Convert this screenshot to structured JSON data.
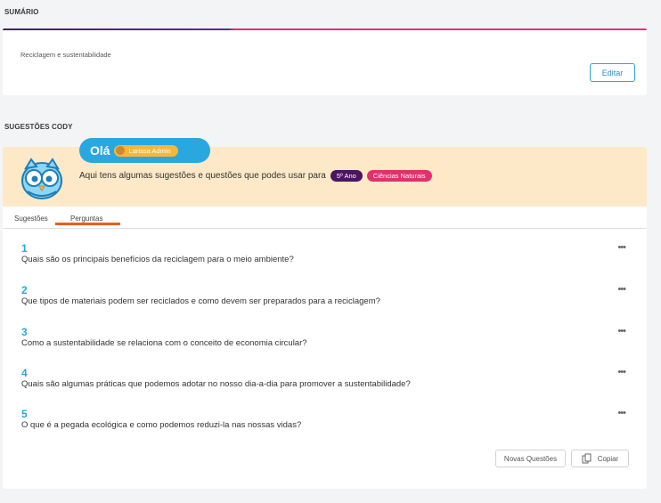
{
  "summary": {
    "section_label": "SUMÁRIO",
    "text": "Reciclagem e sustentabilidade",
    "edit_label": "Editar"
  },
  "cody": {
    "section_label": "SUGESTÕES CODY",
    "greeting": "Olá",
    "user_name": "Larissa Admin",
    "intro_text": "Aqui tens algumas sugestões e questões que podes usar para",
    "year_pill": "5º Ano",
    "subject_pill": "Ciências Naturais",
    "tabs": [
      {
        "label": "Sugestões",
        "active": false
      },
      {
        "label": "Perguntas",
        "active": true
      }
    ],
    "questions": [
      {
        "number": "1",
        "text": "Quais são os principais benefícios da reciclagem para o meio ambiente?"
      },
      {
        "number": "2",
        "text": "Que tipos de materiais podem ser reciclados e como devem ser preparados para a reciclagem?"
      },
      {
        "number": "3",
        "text": "Como a sustentabilidade se relaciona com o conceito de economia circular?"
      },
      {
        "number": "4",
        "text": "Quais são algumas práticas que podemos adotar no nosso dia-a-dia para promover a sustentabilidade?"
      },
      {
        "number": "5",
        "text": "O que é a pegada ecológica e como podemos reduzi-la nas nossas vidas?"
      }
    ],
    "more_glyph": "•••",
    "new_questions_label": "Novas Questões",
    "copy_label": "Copiar"
  },
  "colors": {
    "accent_blue": "#2aa7d8",
    "banner_bg": "#fde8c7",
    "year_pill": "#4b1562",
    "subject_pill": "#e0316d",
    "tab_active_underline": "#f05a22"
  }
}
